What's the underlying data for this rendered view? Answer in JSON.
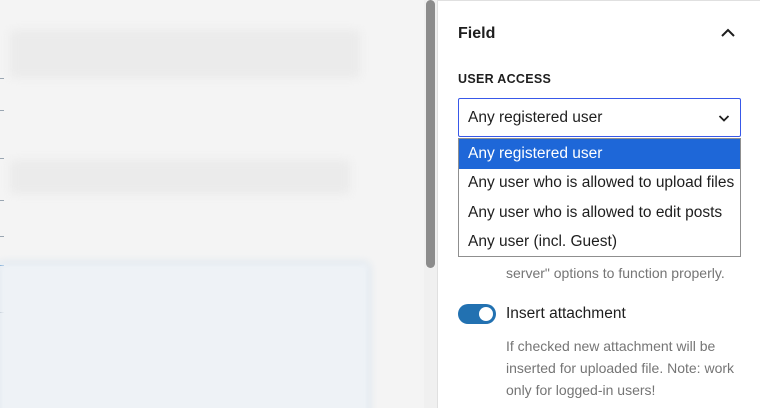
{
  "panel": {
    "title": "Field",
    "section_label": "USER ACCESS",
    "user_access_select": {
      "value": "Any registered user",
      "options": [
        "Any registered user",
        "Any user who is allowed to upload files",
        "Any user who is allowed to edit posts",
        "Any user (incl. Guest)"
      ]
    },
    "partial_help_text": "server\" options to function properly.",
    "insert_attachment": {
      "label": "Insert attachment",
      "checked": true,
      "help": "If checked new attachment will be inserted for uploaded file. Note: work only for logged-in users!"
    }
  },
  "colors": {
    "accent": "#3858e9",
    "selected_option": "#1e67d8",
    "toggle_on": "#2271b1",
    "help_text": "#757575"
  }
}
